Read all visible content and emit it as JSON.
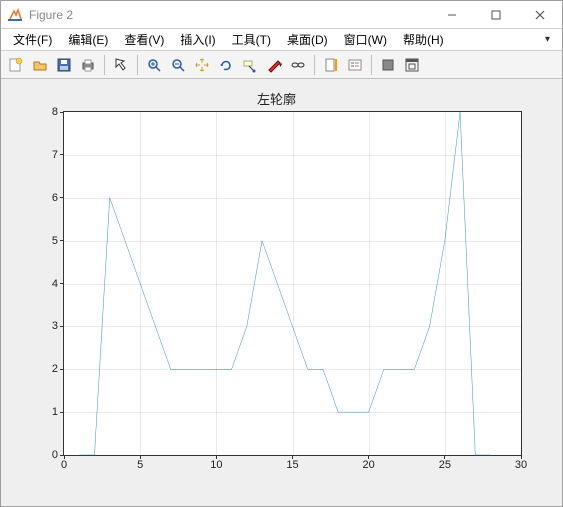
{
  "window": {
    "title": "Figure 2"
  },
  "menu": {
    "file": "文件(F)",
    "edit": "编辑(E)",
    "view": "查看(V)",
    "insert": "插入(I)",
    "tools": "工具(T)",
    "desktop": "桌面(D)",
    "window_menu": "窗口(W)",
    "help": "帮助(H)"
  },
  "chart_data": {
    "type": "line",
    "title": "左轮廓",
    "xlabel": "",
    "ylabel": "",
    "xlim": [
      0,
      30
    ],
    "ylim": [
      0,
      8
    ],
    "xticks": [
      0,
      5,
      10,
      15,
      20,
      25,
      30
    ],
    "yticks": [
      0,
      1,
      2,
      3,
      4,
      5,
      6,
      7,
      8
    ],
    "x": [
      1,
      2,
      3,
      4,
      5,
      6,
      7,
      8,
      9,
      10,
      11,
      12,
      13,
      14,
      15,
      16,
      17,
      18,
      19,
      20,
      21,
      22,
      23,
      24,
      25,
      26,
      27,
      28
    ],
    "values": [
      0,
      0,
      6,
      5,
      4,
      3,
      2,
      2,
      2,
      2,
      2,
      3,
      5,
      4,
      3,
      2,
      2,
      1,
      1,
      1,
      2,
      2,
      2,
      3,
      5,
      8,
      0,
      0
    ],
    "color": "#0072BD"
  }
}
